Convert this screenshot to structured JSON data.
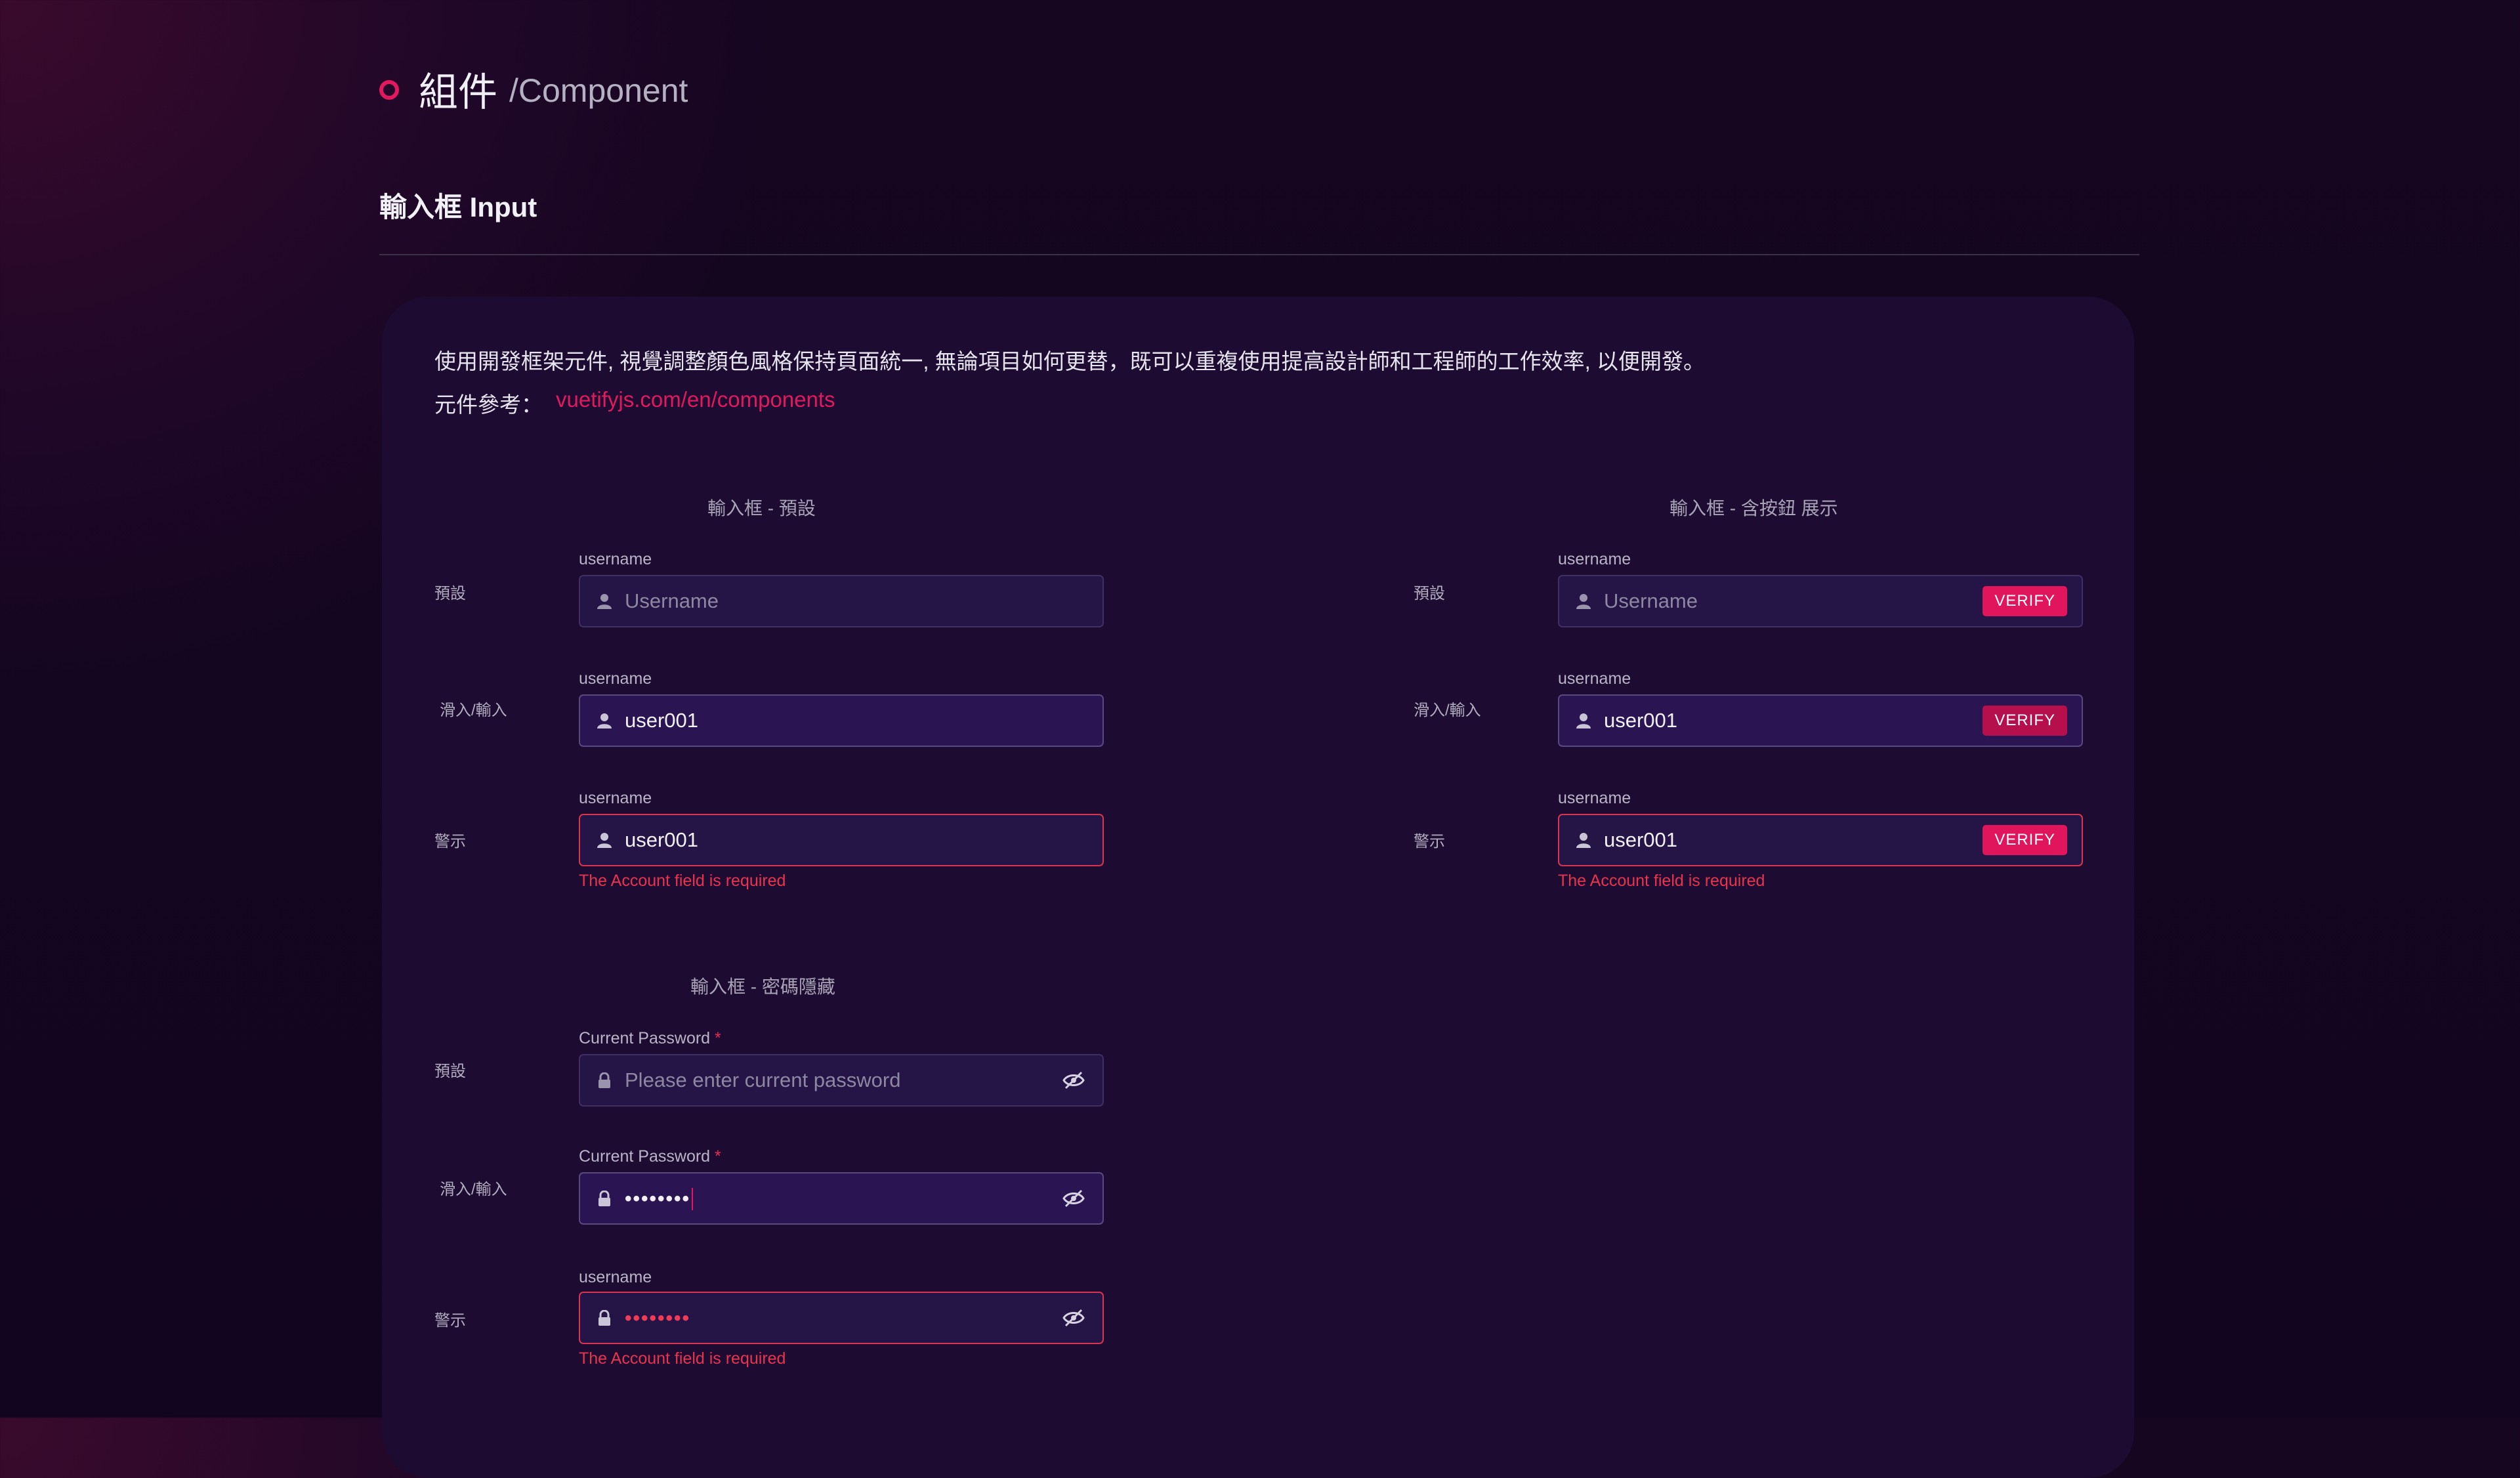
{
  "header": {
    "title": "組件",
    "subtitle": "/Component"
  },
  "section": {
    "title": "輸入框 Input"
  },
  "card": {
    "description": "使用開發框架元件, 視覺調整顏色風格保持頁面統一, 無論項目如何更替，既可以重複使用提高設計師和工程師的工作效率, 以便開發。",
    "reference_label": "元件參考：",
    "reference_link": "vuetifyjs.com/en/components"
  },
  "colors": {
    "accent": "#e2195f",
    "error": "#e8344f",
    "card_bg": "#1d0b31",
    "field_bg": "#251446"
  },
  "groups": {
    "default": {
      "title": "輸入框 - 預設",
      "rows": [
        {
          "label": "預設",
          "field_label": "username",
          "icon": "user-icon",
          "placeholder": "Username",
          "value": ""
        },
        {
          "label": "滑入/輸入",
          "field_label": "username",
          "icon": "user-icon",
          "placeholder": "",
          "value": "user001"
        },
        {
          "label": "警示",
          "field_label": "username",
          "icon": "user-icon",
          "placeholder": "",
          "value": "user001",
          "error": "The Account field is required"
        }
      ]
    },
    "with_button": {
      "title": "輸入框 - 含按鈕 展示",
      "button_label": "VERIFY",
      "rows": [
        {
          "label": "預設",
          "field_label": "username",
          "icon": "user-icon",
          "placeholder": "Username",
          "value": ""
        },
        {
          "label": "滑入/輸入",
          "field_label": "username",
          "icon": "user-icon",
          "placeholder": "",
          "value": "user001"
        },
        {
          "label": "警示",
          "field_label": "username",
          "icon": "user-icon",
          "placeholder": "",
          "value": "user001",
          "error": "The Account field is required"
        }
      ]
    },
    "password": {
      "title": "輸入框 - 密碼隱藏",
      "rows": [
        {
          "label": "預設",
          "field_label": "Current Password",
          "required_mark": "*",
          "icon": "lock-icon",
          "placeholder": "Please enter current password",
          "value": ""
        },
        {
          "label": "滑入/輸入",
          "field_label": "Current Password",
          "required_mark": "*",
          "icon": "lock-icon",
          "placeholder": "",
          "value": "••••••••"
        },
        {
          "label": "警示",
          "field_label": "username",
          "icon": "lock-icon",
          "placeholder": "",
          "value": "••••••••",
          "error": "The Account field is required"
        }
      ]
    }
  }
}
